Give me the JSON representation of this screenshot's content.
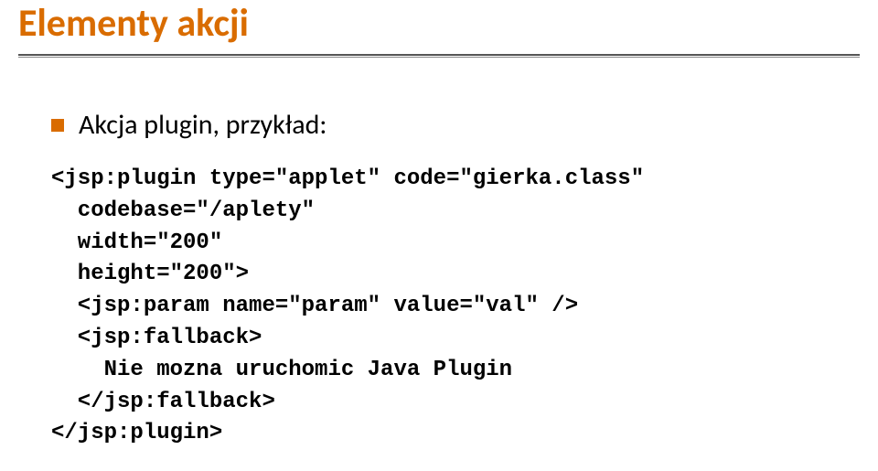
{
  "slide": {
    "title": "Elementy akcji",
    "bullet_text": "Akcja plugin, przykład:",
    "code": "<jsp:plugin type=\"applet\" code=\"gierka.class\"\n  codebase=\"/aplety\"\n  width=\"200\"\n  height=\"200\">\n  <jsp:param name=\"param\" value=\"val\" />\n  <jsp:fallback>\n    Nie mozna uruchomic Java Plugin\n  </jsp:fallback>\n</jsp:plugin>"
  }
}
